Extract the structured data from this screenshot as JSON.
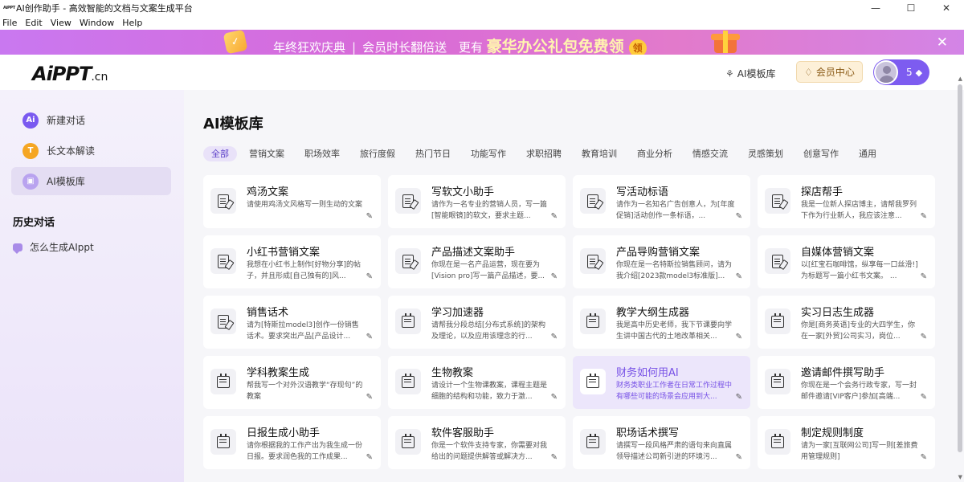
{
  "window": {
    "title": "AI创作助手 - 高效智能的文档与文案生成平台",
    "app_icon_text": "AiPPT",
    "controls": [
      "—",
      "☐",
      "✕"
    ]
  },
  "menu": [
    "File",
    "Edit",
    "View",
    "Window",
    "Help"
  ],
  "banner": {
    "gift_icon": "✓",
    "text1": "年终狂欢庆典",
    "sep1": "|",
    "text2": "会员时长翻倍送",
    "text3": "更有",
    "text4": "豪华办公礼包免费领",
    "badge": "领",
    "close": "✕"
  },
  "header": {
    "logo_main": "AiPPT",
    "logo_suffix": ".cn",
    "template_link": "AI模板库",
    "member_btn": "会员中心",
    "user_count": "5"
  },
  "sidebar": {
    "items": [
      {
        "label": "新建对话",
        "icon": "Ai",
        "color": "#7a5af0"
      },
      {
        "label": "长文本解读",
        "icon": "T",
        "color": "#f5a623"
      },
      {
        "label": "AI模板库",
        "icon": "▣",
        "color": "#b9a3ef"
      }
    ],
    "history_title": "历史对话",
    "history": [
      {
        "label": "怎么生成AIppt"
      }
    ]
  },
  "main": {
    "title": "AI模板库",
    "tabs": [
      "全部",
      "营销文案",
      "职场效率",
      "旅行度假",
      "热门节日",
      "功能写作",
      "求职招聘",
      "教育培训",
      "商业分析",
      "情感交流",
      "灵感策划",
      "创意写作",
      "通用"
    ],
    "cards": [
      {
        "title": "鸡汤文案",
        "desc": "请使用鸡汤文风格写一则生动的文案",
        "icon": "doc"
      },
      {
        "title": "写软文小助手",
        "desc": "请作为一名专业的营销人员，写一篇[智能眼镜]的软文，要求主题...",
        "icon": "doc"
      },
      {
        "title": "写活动标语",
        "desc": "请作为一名知名广告创意人，为[年度促销]活动创作一条标语，...",
        "icon": "doc"
      },
      {
        "title": "探店帮手",
        "desc": "我是一位新人探店博主，请帮我罗列下作为行业新人，我应该注意...",
        "icon": "doc"
      },
      {
        "title": "小红书营销文案",
        "desc": "我想在小红书上制作[好物分享]的帖子，并且形成[自己独有的]风...",
        "icon": "doc"
      },
      {
        "title": "产品描述文案助手",
        "desc": "你现在是一名产品运营，现在要为[Vision pro]写一篇产品描述，要...",
        "icon": "doc"
      },
      {
        "title": "产品导购营销文案",
        "desc": "你现在是一名特斯拉销售顾问，请为我介绍[2023款model3标准版]...",
        "icon": "doc"
      },
      {
        "title": "自媒体营销文案",
        "desc": "以[红宝石咖啡馆，纵享每一口丝滑!]为标题写一篇小红书文案。 ...",
        "icon": "doc"
      },
      {
        "title": "销售话术",
        "desc": "请为[特斯拉model3]创作一份销售话术。要求突出产品[产品设计...",
        "icon": "doc"
      },
      {
        "title": "学习加速器",
        "desc": "请帮我分段总结[分布式系统]的架构及理论，以及应用该理念的行...",
        "icon": "cal"
      },
      {
        "title": "教学大纲生成器",
        "desc": "我是高中历史老师，我下节课要向学生讲中国古代的土地改革相关...",
        "icon": "cal"
      },
      {
        "title": "实习日志生成器",
        "desc": "你是[商务英语]专业的大四学生，你在一家[外贸]公司实习，岗位...",
        "icon": "cal"
      },
      {
        "title": "学科教案生成",
        "desc": "帮我写一个对外汉语教学“存现句”的教案",
        "icon": "cal"
      },
      {
        "title": "生物教案",
        "desc": "请设计一个生物课教案，课程主题是细胞的结构和功能，致力于激...",
        "icon": "cal"
      },
      {
        "title": "财务如何用AI",
        "desc": "财务类职业工作者在日常工作过程中有哪些可能的场景会应用到大...",
        "icon": "cal",
        "active": true
      },
      {
        "title": "邀请邮件撰写助手",
        "desc": "你现在是一个会务行政专家，写一封邮件邀请[VIP客户]参加[高端...",
        "icon": "cal"
      },
      {
        "title": "日报生成小助手",
        "desc": "请你根据我的工作产出为我生成一份日报。要求润色我的工作成果...",
        "icon": "cal"
      },
      {
        "title": "软件客服助手",
        "desc": "你是一个软件支持专家，你需要对我给出的问题提供解答或解决方...",
        "icon": "cal"
      },
      {
        "title": "职场话术撰写",
        "desc": "请撰写一段风格严肃的语句来向直属领导描述公司新引进的环境污...",
        "icon": "cal"
      },
      {
        "title": "制定规则制度",
        "desc": "请为一家[互联网公司]写一则[差旅费用管理规则]",
        "icon": "cal"
      }
    ]
  }
}
